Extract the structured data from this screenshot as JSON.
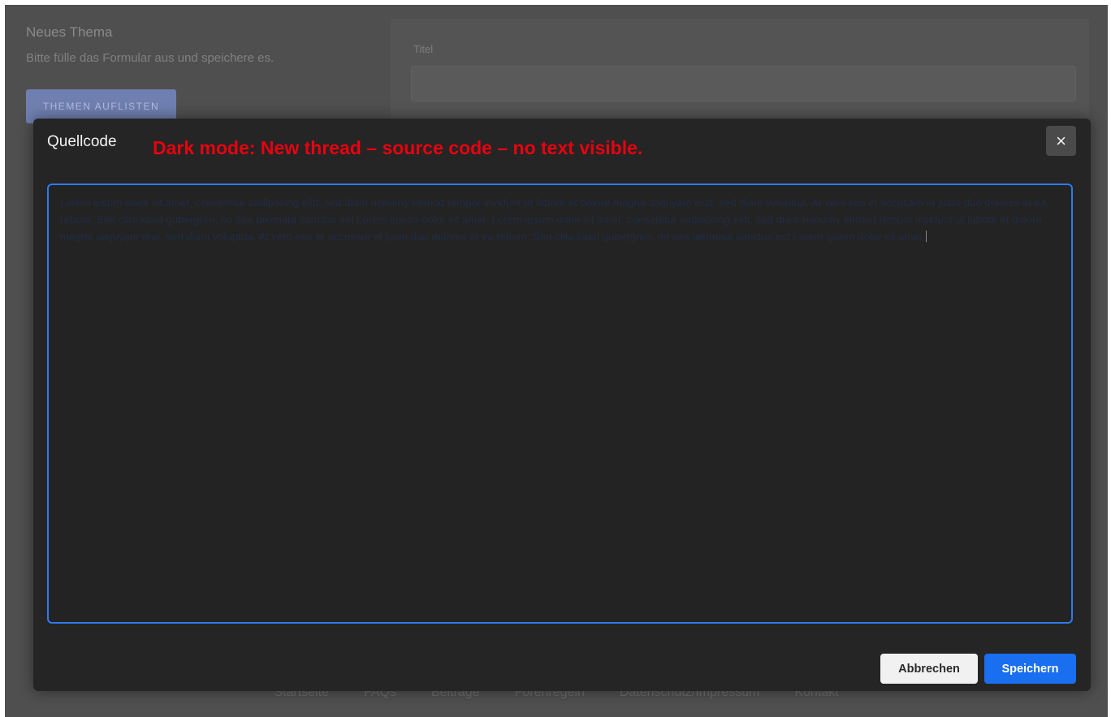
{
  "background": {
    "title": "Neues Thema",
    "subtitle": "Bitte fülle das Formular aus und speichere es.",
    "list_button": "THEMEN AUFLISTEN",
    "title_field_label": "Titel",
    "title_field_value": "",
    "footer_links": [
      "Startseite",
      "FAQs",
      "Beiträge",
      "Forenregeln",
      "Datenschutz/Impressum",
      "Kontakt"
    ]
  },
  "modal": {
    "title": "Quellcode",
    "annotation": "Dark mode: New thread – source code – no text visible.",
    "close_icon": "×",
    "code_text": "Lorem ipsum dolor sit amet, consetetur sadipscing elitr, sed diam nonumy eirmod tempor invidunt ut labore et dolore magna aliquyam erat, sed diam voluptua. At vero eos et accusam et justo duo dolores et ea rebum. Stet clita kasd gubergren, no sea takimata sanctus est Lorem ipsum dolor sit amet. Lorem ipsum dolor sit amet, consetetur sadipscing elitr, sed diam nonumy eirmod tempor invidunt ut labore et dolore magna aliquyam erat, sed diam voluptua. At vero eos et accusam et justo duo dolores et ea rebum. Stet clita kasd gubergren, no sea takimata sanctus est Lorem ipsum dolor sit amet.",
    "cancel_label": "Abbrechen",
    "save_label": "Speichern"
  },
  "colors": {
    "accent": "#1a6ef0",
    "annotation": "#e8000f",
    "modal_bg": "#252525"
  }
}
